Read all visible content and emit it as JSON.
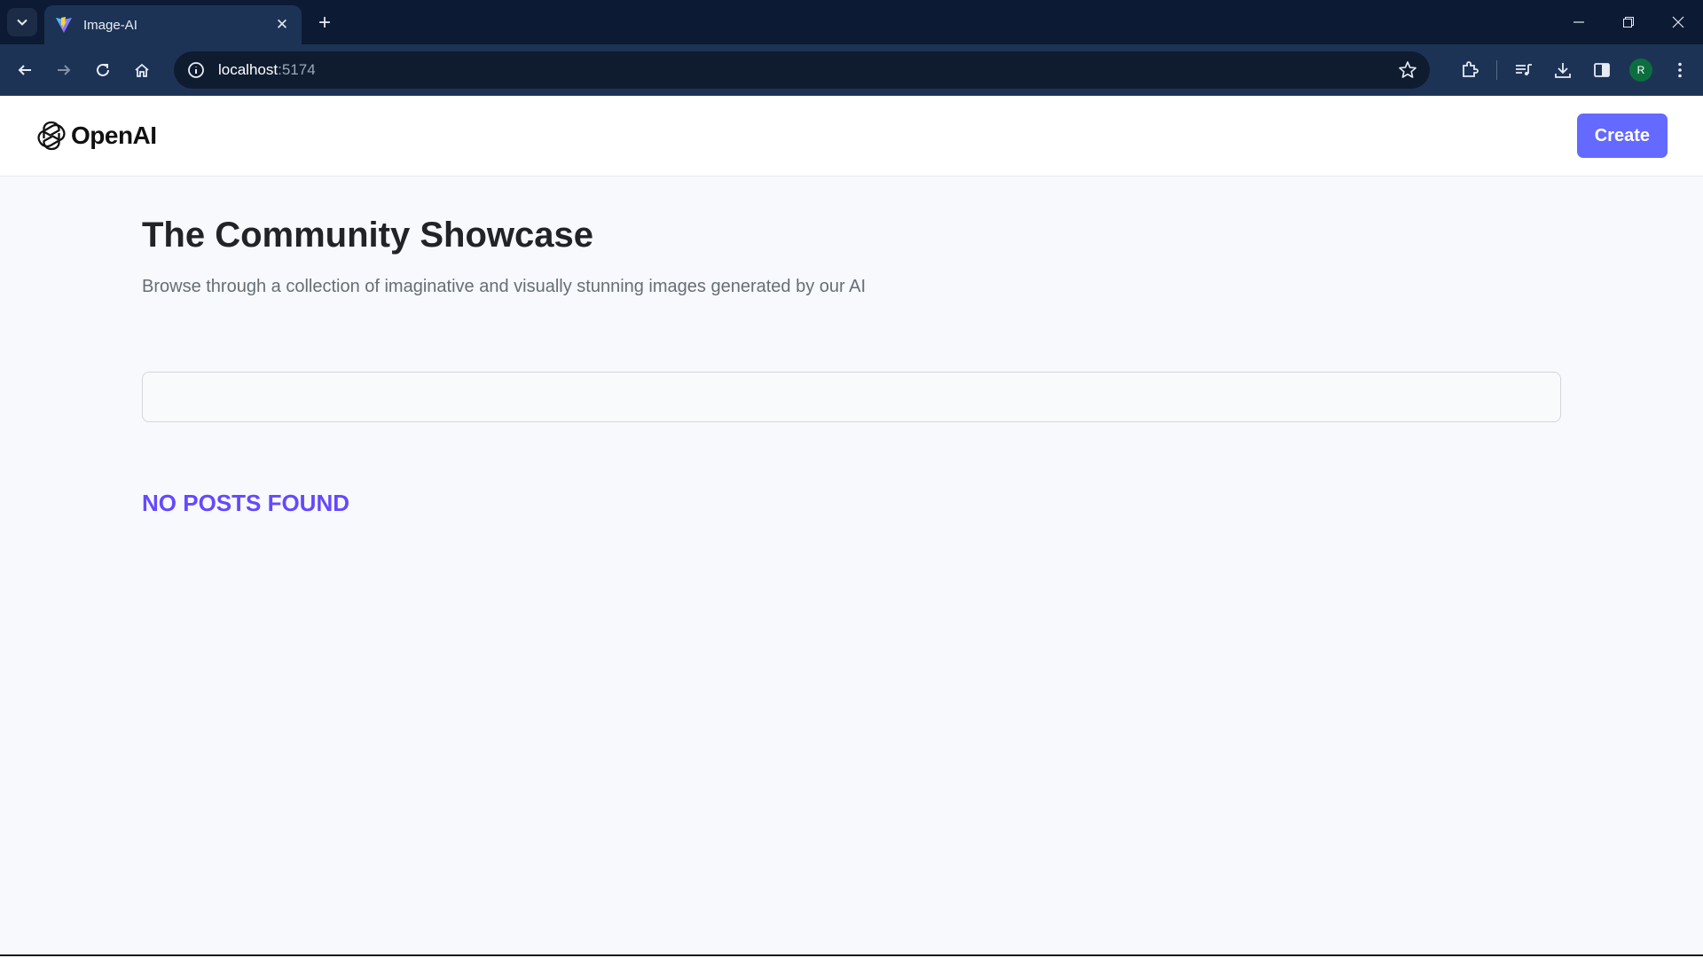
{
  "browser": {
    "tab_title": "Image-AI",
    "url_host": "localhost",
    "url_port": ":5174",
    "profile_initial": "R"
  },
  "header": {
    "logo_text": "OpenAI",
    "create_label": "Create"
  },
  "main": {
    "title": "The Community Showcase",
    "subtitle": "Browse through a collection of imaginative and visually stunning images generated by our AI",
    "search_value": "",
    "empty_message": "NO POSTS FOUND"
  },
  "colors": {
    "accent": "#6469ff",
    "empty_text": "#6449ff",
    "browser_frame": "#0c1a33"
  }
}
